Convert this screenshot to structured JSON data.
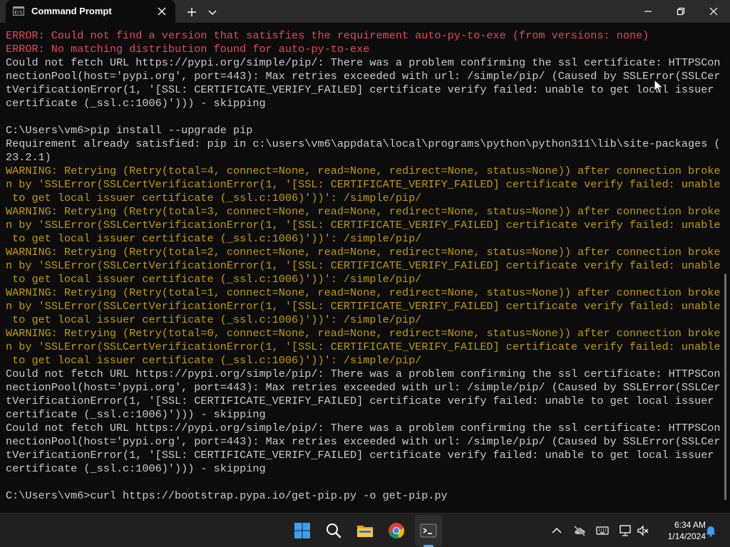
{
  "window": {
    "tab_title": "Command Prompt",
    "icons": [
      "cmd-icon",
      "close-icon",
      "plus-icon",
      "chevron-down-icon",
      "minimize-icon",
      "maximize-icon",
      "close-window-icon"
    ]
  },
  "terminal": {
    "lines": [
      {
        "text": "ERROR: Could not find a version that satisfies the requirement auto-py-to-exe (from versions: none)",
        "kind": "error"
      },
      {
        "text": "ERROR: No matching distribution found for auto-py-to-exe",
        "kind": "error"
      },
      {
        "text": "Could not fetch URL https://pypi.org/simple/pip/: There was a problem confirming the ssl certificate: HTTPSCon",
        "kind": "normal"
      },
      {
        "text": "nectionPool(host='pypi.org', port=443): Max retries exceeded with url: /simple/pip/ (Caused by SSLError(SSLCer",
        "kind": "normal"
      },
      {
        "text": "tVerificationError(1, '[SSL: CERTIFICATE_VERIFY_FAILED] certificate verify failed: unable to get local issuer",
        "kind": "normal"
      },
      {
        "text": "certificate (_ssl.c:1006)'))) - skipping",
        "kind": "normal"
      },
      {
        "text": "",
        "kind": "normal"
      },
      {
        "text": "C:\\Users\\vm6>pip install --upgrade pip",
        "kind": "normal"
      },
      {
        "text": "Requirement already satisfied: pip in c:\\users\\vm6\\appdata\\local\\programs\\python\\python311\\lib\\site-packages (",
        "kind": "normal"
      },
      {
        "text": "23.2.1)",
        "kind": "normal"
      },
      {
        "text": "WARNING: Retrying (Retry(total=4, connect=None, read=None, redirect=None, status=None)) after connection broke",
        "kind": "warning"
      },
      {
        "text": "n by 'SSLError(SSLCertVerificationError(1, '[SSL: CERTIFICATE_VERIFY_FAILED] certificate verify failed: unable",
        "kind": "warning"
      },
      {
        "text": " to get local issuer certificate (_ssl.c:1006)'))': /simple/pip/",
        "kind": "warning"
      },
      {
        "text": "WARNING: Retrying (Retry(total=3, connect=None, read=None, redirect=None, status=None)) after connection broke",
        "kind": "warning"
      },
      {
        "text": "n by 'SSLError(SSLCertVerificationError(1, '[SSL: CERTIFICATE_VERIFY_FAILED] certificate verify failed: unable",
        "kind": "warning"
      },
      {
        "text": " to get local issuer certificate (_ssl.c:1006)'))': /simple/pip/",
        "kind": "warning"
      },
      {
        "text": "WARNING: Retrying (Retry(total=2, connect=None, read=None, redirect=None, status=None)) after connection broke",
        "kind": "warning"
      },
      {
        "text": "n by 'SSLError(SSLCertVerificationError(1, '[SSL: CERTIFICATE_VERIFY_FAILED] certificate verify failed: unable",
        "kind": "warning"
      },
      {
        "text": " to get local issuer certificate (_ssl.c:1006)'))': /simple/pip/",
        "kind": "warning"
      },
      {
        "text": "WARNING: Retrying (Retry(total=1, connect=None, read=None, redirect=None, status=None)) after connection broke",
        "kind": "warning"
      },
      {
        "text": "n by 'SSLError(SSLCertVerificationError(1, '[SSL: CERTIFICATE_VERIFY_FAILED] certificate verify failed: unable",
        "kind": "warning"
      },
      {
        "text": " to get local issuer certificate (_ssl.c:1006)'))': /simple/pip/",
        "kind": "warning"
      },
      {
        "text": "WARNING: Retrying (Retry(total=0, connect=None, read=None, redirect=None, status=None)) after connection broke",
        "kind": "warning"
      },
      {
        "text": "n by 'SSLError(SSLCertVerificationError(1, '[SSL: CERTIFICATE_VERIFY_FAILED] certificate verify failed: unable",
        "kind": "warning"
      },
      {
        "text": " to get local issuer certificate (_ssl.c:1006)'))': /simple/pip/",
        "kind": "warning"
      },
      {
        "text": "Could not fetch URL https://pypi.org/simple/pip/: There was a problem confirming the ssl certificate: HTTPSCon",
        "kind": "normal"
      },
      {
        "text": "nectionPool(host='pypi.org', port=443): Max retries exceeded with url: /simple/pip/ (Caused by SSLError(SSLCer",
        "kind": "normal"
      },
      {
        "text": "tVerificationError(1, '[SSL: CERTIFICATE_VERIFY_FAILED] certificate verify failed: unable to get local issuer",
        "kind": "normal"
      },
      {
        "text": "certificate (_ssl.c:1006)'))) - skipping",
        "kind": "normal"
      },
      {
        "text": "Could not fetch URL https://pypi.org/simple/pip/: There was a problem confirming the ssl certificate: HTTPSCon",
        "kind": "normal"
      },
      {
        "text": "nectionPool(host='pypi.org', port=443): Max retries exceeded with url: /simple/pip/ (Caused by SSLError(SSLCer",
        "kind": "normal"
      },
      {
        "text": "tVerificationError(1, '[SSL: CERTIFICATE_VERIFY_FAILED] certificate verify failed: unable to get local issuer",
        "kind": "normal"
      },
      {
        "text": "certificate (_ssl.c:1006)'))) - skipping",
        "kind": "normal"
      },
      {
        "text": "",
        "kind": "normal"
      },
      {
        "text": "C:\\Users\\vm6>curl https://bootstrap.pypa.io/get-pip.py -o get-pip.py",
        "kind": "normal"
      }
    ]
  },
  "colors": {
    "terminal_bg": "#0c0c0c",
    "text": "#cccccc",
    "error": "#e74856",
    "warning": "#c19c00",
    "taskbar": "#202020",
    "accent": "#5ea9e8"
  },
  "taskbar": {
    "apps": [
      "windows-start-icon",
      "search-icon",
      "file-explorer-icon",
      "chrome-icon",
      "terminal-icon"
    ],
    "tray": [
      "chevron-up-icon",
      "cloud-off-icon",
      "keyboard-icon",
      "network-icon",
      "volume-muted-icon",
      "notification-bell-icon"
    ],
    "time": "6:34 AM",
    "date": "1/14/2024"
  }
}
